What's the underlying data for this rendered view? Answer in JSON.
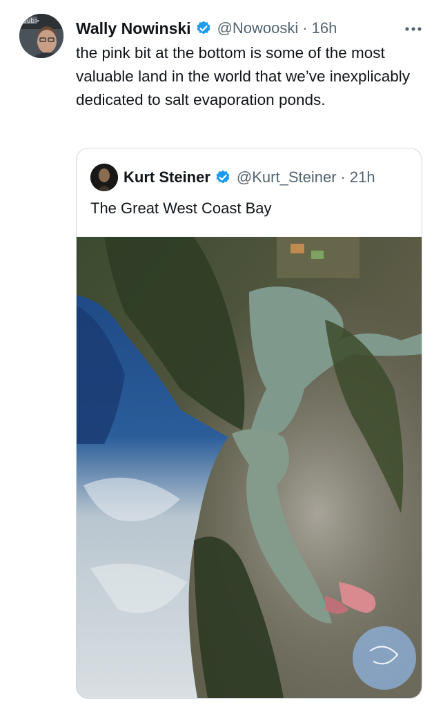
{
  "tweet": {
    "author_name": "Wally Nowinski",
    "author_handle": "@Nowooski",
    "separator": "·",
    "time": "16h",
    "text": "the pink bit at the bottom is some of the most valuable land in the world that we’ve inexplicably dedicated to salt evaporation ponds.",
    "more_icon": "more-horizontal-icon",
    "avatar_badge": "sub>"
  },
  "quoted_tweet": {
    "author_name": "Kurt Steiner",
    "author_handle": "@Kurt_Steiner",
    "separator": "·",
    "time": "21h",
    "text": "The Great West Coast Bay"
  },
  "colors": {
    "verified": "#1d9bf0",
    "handle_gray": "#536471",
    "border": "#cfd9de"
  }
}
